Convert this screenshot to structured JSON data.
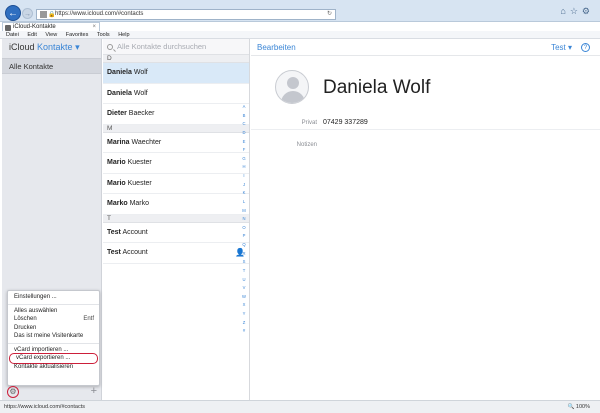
{
  "browser": {
    "url": "https://www.icloud.com/#contacts",
    "tab_title": "iCloud-Kontakte",
    "tab_close": "×",
    "menu": [
      "Datei",
      "Edit",
      "View",
      "Favorites",
      "Tools",
      "Help"
    ],
    "status_url": "https://www.icloud.com/#contacts",
    "zoom": "100%"
  },
  "app": {
    "brand": "iCloud",
    "section": "Kontakte",
    "section_chevron": "▾",
    "sidebar": {
      "group": "Alle Kontakte"
    },
    "context_menu": {
      "items": [
        {
          "label": "Einstellungen ...",
          "shortcut": ""
        },
        {
          "label": "Alles auswählen",
          "shortcut": ""
        },
        {
          "label": "Löschen",
          "shortcut": "Entf"
        },
        {
          "label": "Drucken",
          "shortcut": ""
        },
        {
          "label": "Das ist meine Visitenkarte",
          "shortcut": ""
        },
        {
          "label": "vCard importieren ...",
          "shortcut": ""
        },
        {
          "label": "vCard exportieren ...",
          "shortcut": ""
        },
        {
          "label": "Kontakte aktualisieren",
          "shortcut": ""
        }
      ]
    },
    "bottom": {
      "plus": "+"
    },
    "search": {
      "placeholder": "Alle Kontakte durchsuchen"
    },
    "sections": {
      "d": "D",
      "m": "M",
      "t": "T"
    },
    "contacts": [
      {
        "first": "Daniela",
        "last": "Wolf",
        "selected": true
      },
      {
        "first": "Daniela",
        "last": "Wolf"
      },
      {
        "first": "Dieter",
        "last": "Baecker"
      },
      {
        "first": "Marina",
        "last": "Waechter"
      },
      {
        "first": "Mario",
        "last": "Kuester"
      },
      {
        "first": "Mario",
        "last": "Kuester"
      },
      {
        "first": "Marko",
        "last": "Marko"
      },
      {
        "first": "Test",
        "last": "Account"
      },
      {
        "first": "Test",
        "last": "Account"
      }
    ],
    "alphabet": [
      "A",
      "B",
      "C",
      "D",
      "E",
      "F",
      "G",
      "H",
      "I",
      "J",
      "K",
      "L",
      "M",
      "N",
      "O",
      "P",
      "Q",
      "R",
      "S",
      "T",
      "U",
      "V",
      "W",
      "X",
      "Y",
      "Z",
      "#"
    ],
    "detail": {
      "edit": "Bearbeiten",
      "user": "Test",
      "user_chevron": "▾",
      "help": "?",
      "name": "Daniela Wolf",
      "phone_label": "Privat",
      "phone_value": "07429 337289",
      "notes_label": "Notizen"
    }
  },
  "colors": {
    "accent": "#3b86d6",
    "highlight": "#cc1f3a"
  }
}
